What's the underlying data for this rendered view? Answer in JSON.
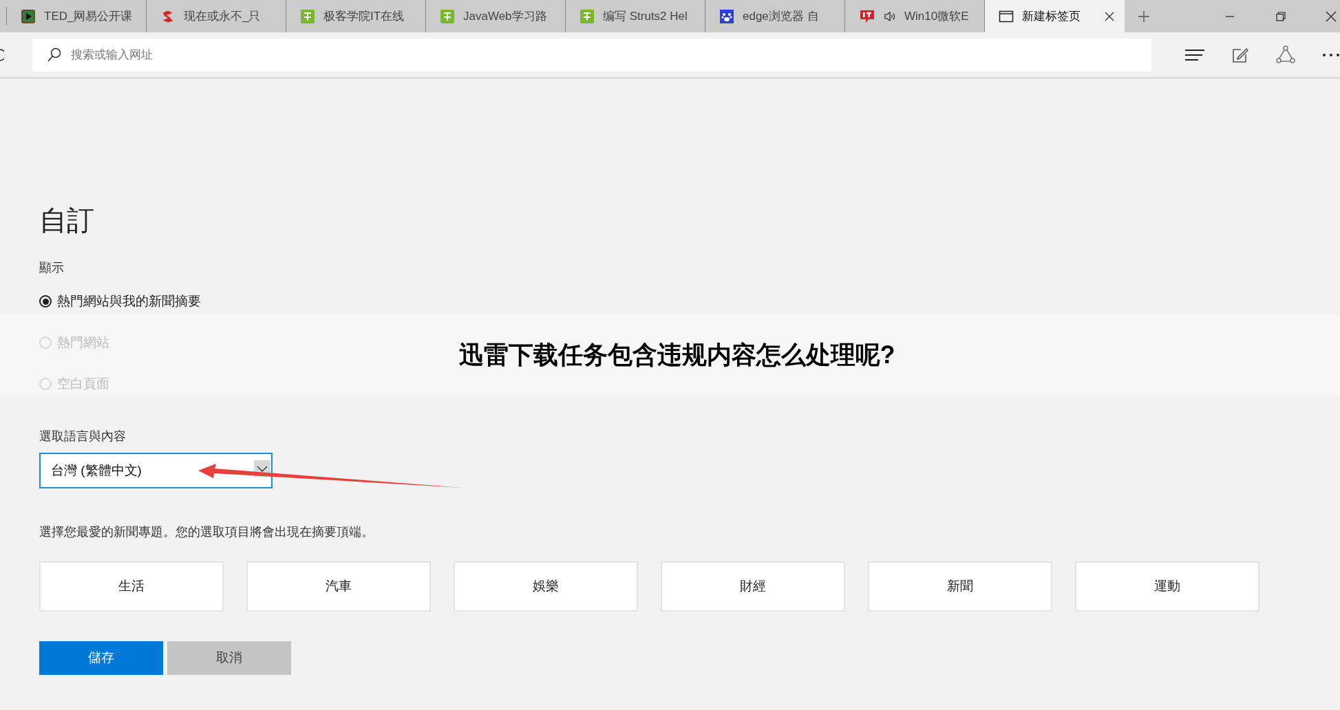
{
  "tabs": [
    {
      "kind": "video",
      "label": "TED_网易公开课",
      "audio": false,
      "selected": false
    },
    {
      "kind": "netease",
      "label": "现在或永不_只",
      "audio": false,
      "selected": false
    },
    {
      "kind": "jike",
      "label": "极客学院IT在线",
      "audio": false,
      "selected": false
    },
    {
      "kind": "jike",
      "label": "JavaWeb学习路",
      "audio": false,
      "selected": false
    },
    {
      "kind": "jike",
      "label": "编写 Struts2 Hel",
      "audio": false,
      "selected": false
    },
    {
      "kind": "paw",
      "label": "edge浏览器 自",
      "audio": false,
      "selected": false
    },
    {
      "kind": "ithome",
      "label": "Win10微软E",
      "audio": true,
      "selected": false
    },
    {
      "kind": "page",
      "label": "新建标签页",
      "audio": false,
      "selected": true
    }
  ],
  "address_bar": {
    "placeholder": "搜索或输入网址"
  },
  "page": {
    "title": "自訂",
    "display_label": "顯示",
    "display_options": [
      {
        "label": "熱門網站與我的新聞摘要",
        "selected": true
      },
      {
        "label": "熱門網站",
        "selected": false
      },
      {
        "label": "空白頁面",
        "selected": false
      }
    ],
    "language_label": "選取語言與內容",
    "language_select": {
      "value": "台灣 (繁體中文)"
    },
    "topics_hint": "選擇您最愛的新聞專題。您的選取項目將會出現在摘要頂端。",
    "topics": [
      {
        "label": "生活",
        "selected": false
      },
      {
        "label": "汽車",
        "selected": false
      },
      {
        "label": "娛樂",
        "selected": false
      },
      {
        "label": "財經",
        "selected": false
      },
      {
        "label": "新聞",
        "selected": false
      },
      {
        "label": "運動",
        "selected": false
      }
    ],
    "buttons": [
      {
        "kind": "primary",
        "label": "儲存"
      },
      {
        "kind": "secondary",
        "label": "取消"
      }
    ]
  },
  "overlay_caption": "迅雷下载任务包含违规内容怎么处理呢?"
}
